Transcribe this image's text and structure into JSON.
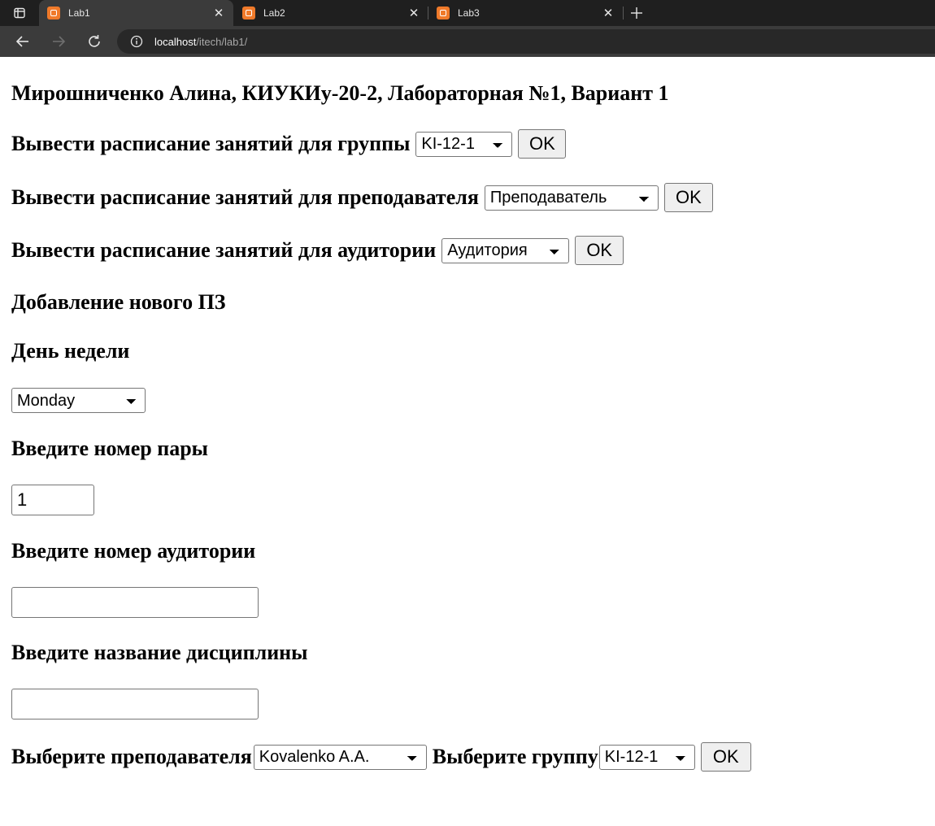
{
  "browser": {
    "tabs": [
      {
        "title": "Lab1",
        "active": true
      },
      {
        "title": "Lab2",
        "active": false
      },
      {
        "title": "Lab3",
        "active": false
      }
    ],
    "url_host": "localhost",
    "url_path": "/itech/lab1/"
  },
  "page": {
    "title": "Мирошниченко Алина, КИУКИу-20-2, Лабораторная №1, Вариант 1",
    "group_schedule": {
      "label": "Вывести расписание занятий для группы",
      "selected": "KI-12-1",
      "button": "OK"
    },
    "teacher_schedule": {
      "label": "Вывести расписание занятий для преподавателя",
      "selected": "Преподаватель",
      "button": "OK"
    },
    "room_schedule": {
      "label": "Вывести расписание занятий для аудитории",
      "selected": "Аудитория",
      "button": "OK"
    },
    "add_heading": "Добавление нового ПЗ",
    "day_label": "День недели",
    "day_selected": "Monday",
    "pair_label": "Введите номер пары",
    "pair_value": "1",
    "room_label": "Введите номер аудитории",
    "room_value": "",
    "discipline_label": "Введите название дисциплины",
    "discipline_value": "",
    "teacher_label": "Выберите преподавателя",
    "teacher_selected": "Kovalenko A.A.",
    "group_label": "Выберите группу",
    "group_selected": "KI-12-1",
    "submit_button": "OK"
  },
  "colors": {
    "tabbar_bg": "#1f1f1f",
    "active_tab_bg": "#3b3b3b",
    "favicon": "#f07a2a",
    "page_bg": "#ffffff"
  }
}
